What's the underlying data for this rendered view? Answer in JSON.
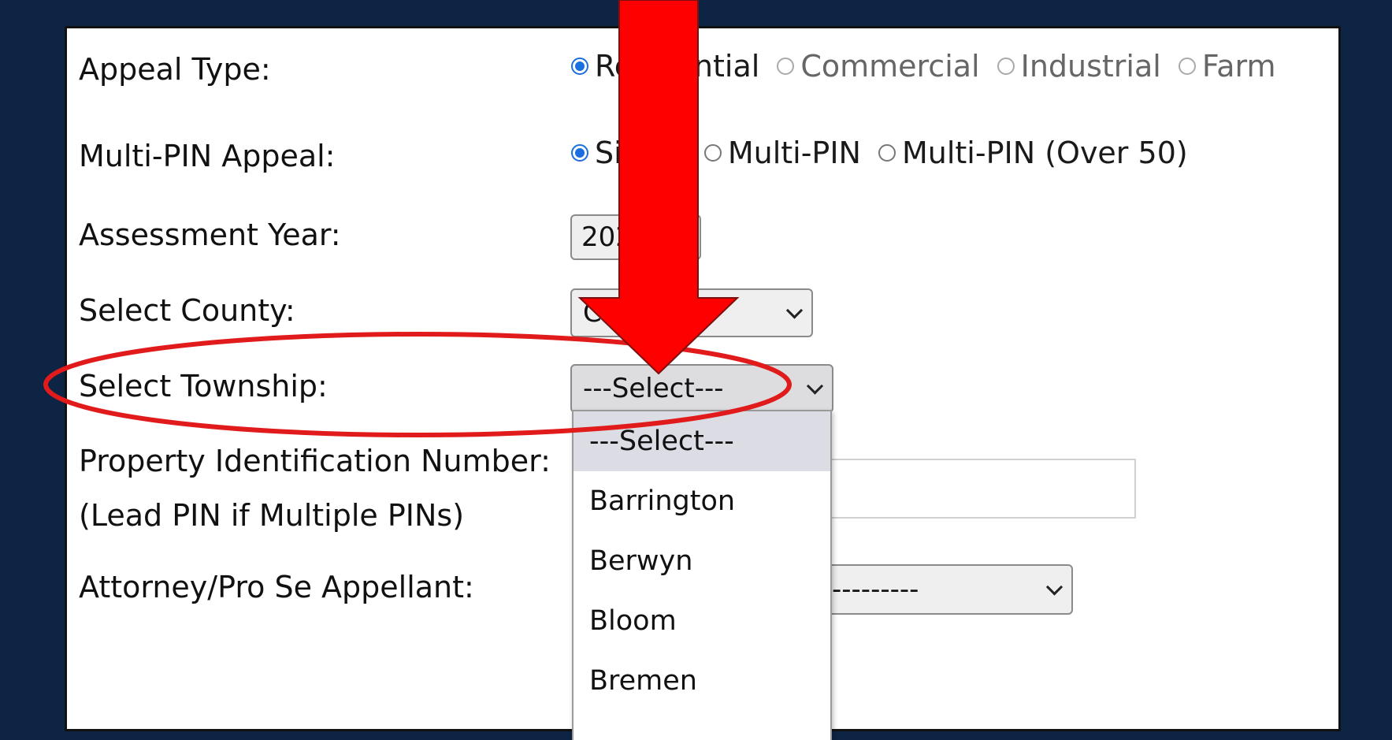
{
  "form": {
    "appeal_type": {
      "label": "Appeal Type:",
      "options": [
        "Residential",
        "Commercial",
        "Industrial",
        "Farm"
      ],
      "selected": "Residential"
    },
    "multi_pin": {
      "label": "Multi-PIN Appeal:",
      "options": [
        "Single",
        "Multi-PIN",
        "Multi-PIN (Over 50)"
      ],
      "selected": "Single"
    },
    "assessment_year": {
      "label": "Assessment Year:",
      "value": "2024"
    },
    "county": {
      "label": "Select County:",
      "value": "Cook"
    },
    "township": {
      "label": "Select Township:",
      "value": "---Select---",
      "options": [
        "---Select---",
        "Barrington",
        "Berwyn",
        "Bloom",
        "Bremen"
      ]
    },
    "pin": {
      "label": "Property Identification Number:",
      "sublabel": "(Lead PIN if Multiple PINs)",
      "value": ""
    },
    "attorney": {
      "label": "Attorney/Pro Se Appellant:",
      "value": "---------"
    }
  },
  "colors": {
    "background": "#0d2444",
    "arrow": "#ff0000",
    "ellipse": "#e11b1b",
    "radio_on": "#1a6fe0"
  }
}
